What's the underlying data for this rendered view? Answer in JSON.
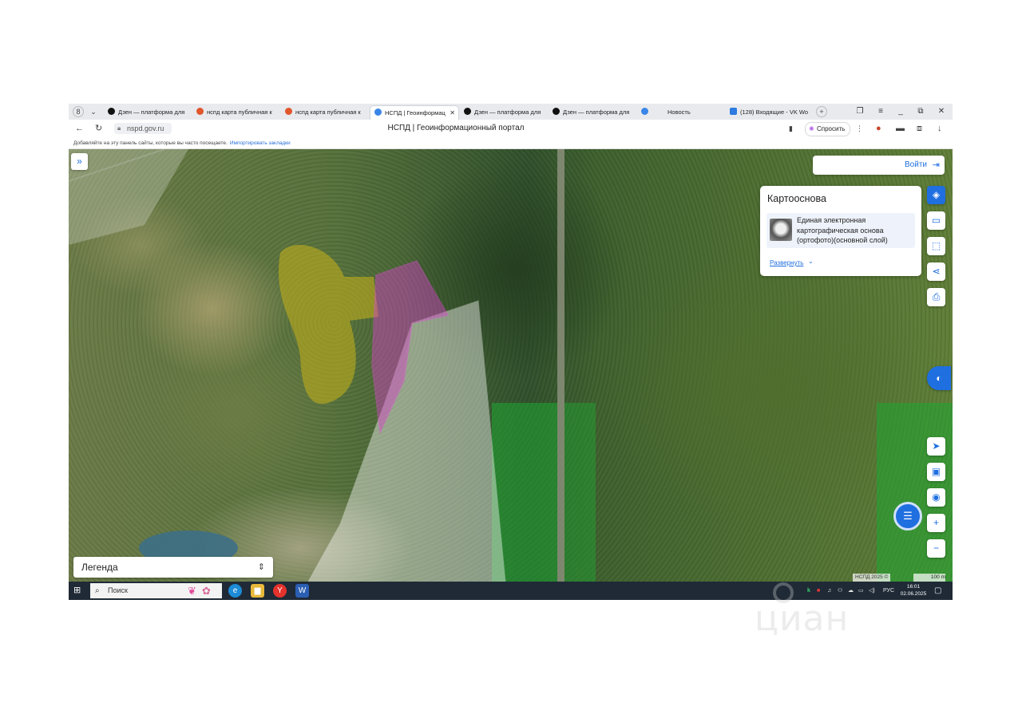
{
  "browser": {
    "profile_badge": "8",
    "tabs": [
      {
        "label": "Дзен — платформа для",
        "active": false,
        "favicon_color": "#111111"
      },
      {
        "label": "нспд карта публичная к",
        "active": false,
        "favicon_color": "#e2562c"
      },
      {
        "label": "нспд карта публичная к",
        "active": false,
        "favicon_color": "#e2562c"
      },
      {
        "label": "НСПД | Геоинформац",
        "active": true,
        "favicon_color": "#3a86e8"
      },
      {
        "label": "Дзен — платформа для",
        "active": false,
        "favicon_color": "#111111"
      },
      {
        "label": "Дзен — платформа для",
        "active": false,
        "favicon_color": "#111111"
      },
      {
        "label": "Новость",
        "active": false,
        "favicon_color": "#3a86e8"
      },
      {
        "label": "(128) Входящие - VK Wo",
        "active": false,
        "favicon_color": "#2d7be0"
      }
    ],
    "url": "nspd.gov.ru",
    "page_title": "НСПД | Геоинформационный портал",
    "ask_button": "Спросить",
    "bookmarks_bar": {
      "text": "Добавляйте на эту панель сайты, которые вы часто посещаете.",
      "link": "Импортировать закладки"
    }
  },
  "map": {
    "login_label": "Войти",
    "basemap_panel": {
      "title": "Картооснова",
      "layer_name": "Единая электронная картографическая основа (ортофото)(основной слой)",
      "expand_link": "Развернуть"
    },
    "legend_label": "Легенда",
    "attribution": "НСПД 2025 ©",
    "scale_label": "100 m",
    "polygon_colors": {
      "yellow": "#c9b21a",
      "magenta": "#d640c8",
      "white": "#ffffff",
      "green": "#1ea832"
    }
  },
  "taskbar": {
    "search_label": "Поиск",
    "language": "РУС",
    "time": "16:01",
    "date": "02.06.2025"
  },
  "watermark": "циан"
}
